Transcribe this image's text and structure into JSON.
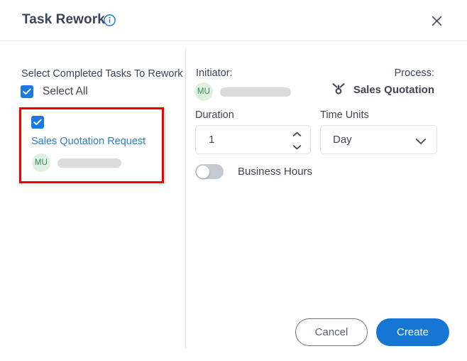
{
  "dialog": {
    "title": "Task Rework",
    "info_icon": "info-icon",
    "close_icon": "close-icon"
  },
  "left": {
    "heading": "Select Completed Tasks To Rework",
    "select_all_label": "Select All",
    "select_all_checked": "checked",
    "task": {
      "checked": "checked",
      "title": "Sales Quotation Request",
      "avatar_initials": "MU",
      "assignee_name": ""
    }
  },
  "right": {
    "initiator_label": "Initiator:",
    "initiator_avatar_initials": "MU",
    "initiator_name": "",
    "process_label": "Process:",
    "process_name": "Sales Quotation",
    "process_icon": "process-node-icon",
    "duration_label": "Duration",
    "duration_value": "1",
    "time_units_label": "Time Units",
    "time_units_value": "Day",
    "time_units_options": [
      "Day"
    ],
    "business_hours_label": "Business Hours",
    "business_hours_state": "off"
  },
  "footer": {
    "cancel_label": "Cancel",
    "create_label": "Create"
  },
  "colors": {
    "accent_blue": "#1676d4",
    "checkbox_blue": "#1b7ae0",
    "link_blue": "#2f7fd1",
    "avatar_green_bg": "#dff0e2",
    "avatar_green_text": "#2f8f4e",
    "highlight_red": "#f10000",
    "text": "#3f4556"
  }
}
